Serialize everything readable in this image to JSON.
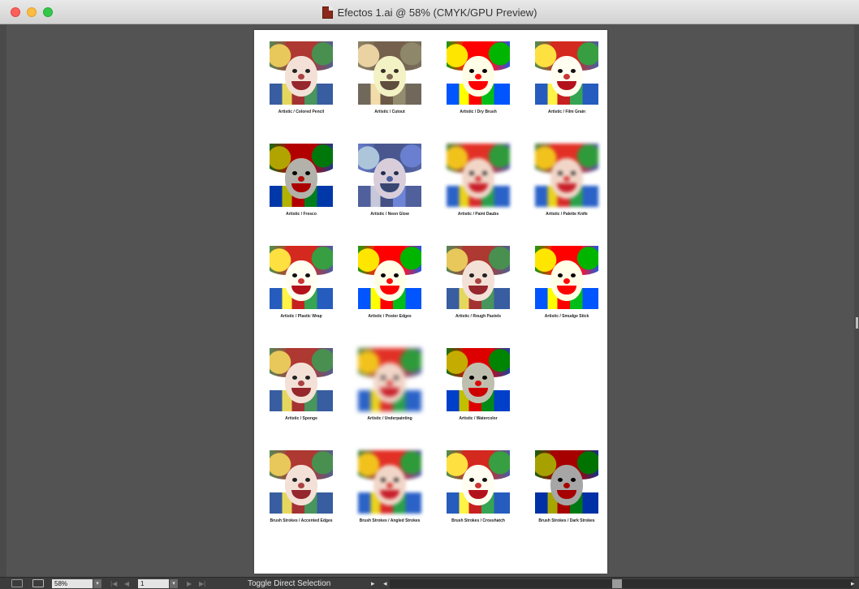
{
  "window": {
    "title": "Efectos 1.ai @ 58% (CMYK/GPU Preview)"
  },
  "thumbnails": [
    {
      "caption": "Artistic / Colored Pencil",
      "style": "pencil"
    },
    {
      "caption": "Artistic / Cutout",
      "style": "cutout"
    },
    {
      "caption": "Artistic / Dry Brush",
      "style": "poster"
    },
    {
      "caption": "Artistic / Film Grain",
      "style": "plastic"
    },
    {
      "caption": "Artistic / Fresco",
      "style": "dark"
    },
    {
      "caption": "Artistic / Neon Glow",
      "style": "neon"
    },
    {
      "caption": "Artistic / Paint Daubs",
      "style": "blur"
    },
    {
      "caption": "Artistic / Palette Knife",
      "style": "blur"
    },
    {
      "caption": "Artistic / Plastic Wrap",
      "style": "plastic"
    },
    {
      "caption": "Artistic / Poster Edges",
      "style": "poster"
    },
    {
      "caption": "Artistic / Rough Pastels",
      "style": "pencil"
    },
    {
      "caption": "Artistic / Smudge Stick",
      "style": "poster"
    },
    {
      "caption": "Artistic / Sponge",
      "style": "pencil"
    },
    {
      "caption": "Artistic / Underpainting",
      "style": "blur2"
    },
    {
      "caption": "Artistic / Watercolor",
      "style": "water"
    },
    {
      "caption": "Brush Strokes / Accented Edges",
      "style": "pencil"
    },
    {
      "caption": "Brush Strokes / Angled Strokes",
      "style": "blur"
    },
    {
      "caption": "Brush Strokes / Crosshatch",
      "style": "plastic"
    },
    {
      "caption": "Brush Strokes / Dark Strokes",
      "style": "darkstroke"
    }
  ],
  "statusbar": {
    "zoom": "58%",
    "page": "1",
    "status_text": "Toggle Direct Selection"
  }
}
